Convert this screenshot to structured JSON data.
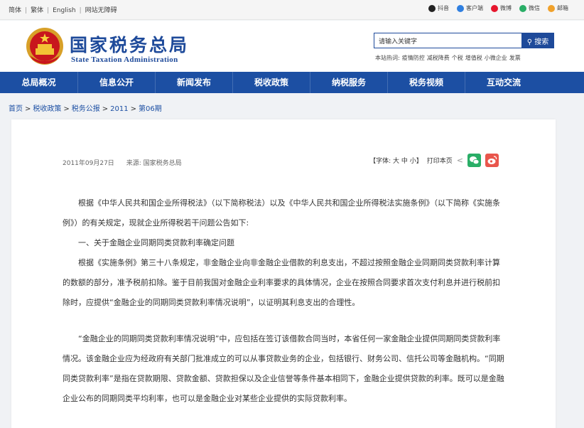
{
  "topbar": {
    "links": [
      "简体",
      "繁体",
      "English",
      "网站无障碍"
    ],
    "social": [
      {
        "label": "抖音",
        "icon": "douyin-icon",
        "color": "#222222"
      },
      {
        "label": "客户端",
        "icon": "mobile-client-icon",
        "color": "#2f7fe0"
      },
      {
        "label": "微博",
        "icon": "weibo-icon",
        "color": "#e6162d"
      },
      {
        "label": "微信",
        "icon": "wechat-icon",
        "color": "#2aae67"
      },
      {
        "label": "邮箱",
        "icon": "mail-icon",
        "color": "#f0a12b"
      }
    ]
  },
  "header": {
    "title_cn": "国家税务总局",
    "title_en": "State Taxation Administration",
    "search_placeholder": "请输入关键字",
    "search_button": "搜索",
    "hot_label": "本站热词:",
    "hot_words": [
      "疫情防控",
      "减税降费",
      "个税",
      "增值税",
      "小微企业",
      "发票"
    ]
  },
  "nav": [
    "总局概况",
    "信息公开",
    "新闻发布",
    "税收政策",
    "纳税服务",
    "税务视频",
    "互动交流"
  ],
  "breadcrumb": [
    "首页",
    "税收政策",
    "税务公报",
    "2011",
    "第06期"
  ],
  "meta": {
    "date": "2011年09月27日",
    "source": "来源: 国家税务总局",
    "font_label": "【字体: 大 中 小】",
    "print_label": "打印本页"
  },
  "article": [
    "根据《中华人民共和国企业所得税法》（以下简称税法）以及《中华人民共和国企业所得税法实施条例》（以下简称《实施条例》）的有关规定，现就企业所得税若干问题公告如下:",
    "一、关于金融企业同期同类贷款利率确定问题",
    "根据《实施条例》第三十八条规定，非金融企业向非金融企业借款的利息支出，不超过按照金融企业同期同类贷款利率计算的数额的部分，准予税前扣除。鉴于目前我国对金融企业利率要求的具体情况，企业在按照合同要求首次支付利息并进行税前扣除时，应提供“金融企业的同期同类贷款利率情况说明”，以证明其利息支出的合理性。",
    "“金融企业的同期同类贷款利率情况说明”中，应包括在签订该借款合同当时，本省任何一家金融企业提供同期同类贷款利率情况。该金融企业应为经政府有关部门批准成立的可以从事贷款业务的企业，包括银行、财务公司、信托公司等金融机构。“同期同类贷款利率”是指在贷款期限、贷款金额、贷款担保以及企业信誉等条件基本相同下，金融企业提供贷款的利率。既可以是金融企业公布的同期同类平均利率，也可以是金融企业对某些企业提供的实际贷款利率。"
  ],
  "colors": {
    "brand_blue": "#1e4a9a",
    "nav_blue": "#1c4fa3"
  }
}
